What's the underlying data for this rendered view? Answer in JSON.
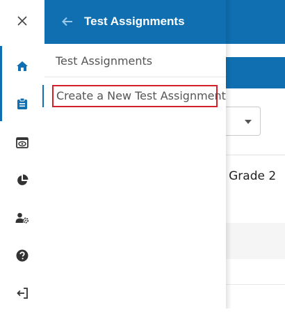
{
  "background": {
    "row_text": "| Grade 2"
  },
  "rail": {
    "items": [
      {
        "icon": "close-icon"
      },
      {
        "icon": "home-icon"
      },
      {
        "icon": "clipboard-icon"
      },
      {
        "icon": "preview-icon"
      },
      {
        "icon": "pie-chart-icon"
      },
      {
        "icon": "user-settings-icon"
      },
      {
        "icon": "help-icon"
      },
      {
        "icon": "logout-icon"
      }
    ],
    "active_index": 2
  },
  "panel": {
    "title": "Test Assignments",
    "menu": [
      {
        "label": "Test Assignments"
      },
      {
        "label": "Create a New Test Assignment"
      }
    ]
  },
  "colors": {
    "brand_blue": "#0f6fb0",
    "highlight_red": "#d3212c",
    "icon_grey": "#333333"
  }
}
